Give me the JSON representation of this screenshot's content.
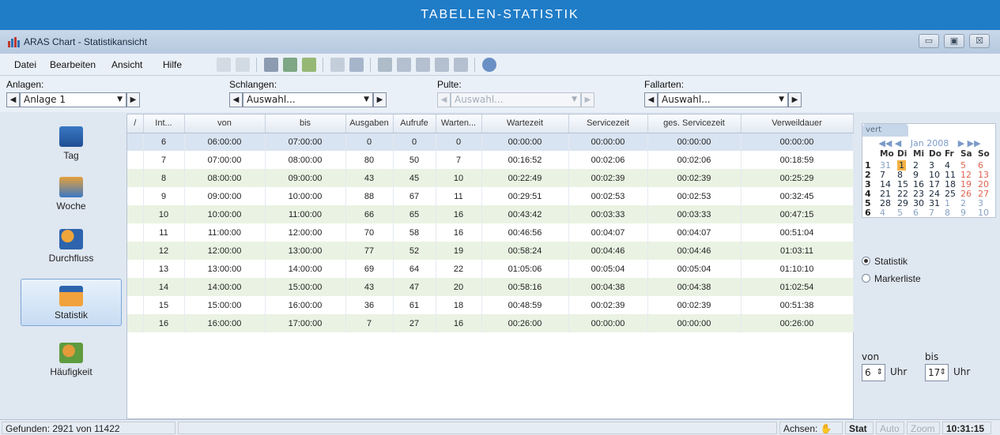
{
  "banner": {
    "title": "TABELLEN-STATISTIK"
  },
  "window": {
    "title": "ARAS Chart - Statistikansicht",
    "btn_min": "▭",
    "btn_max": "▣",
    "btn_close": "☒"
  },
  "menu": {
    "datei": "Datei",
    "bearbeiten": "Bearbeiten",
    "ansicht": "Ansicht",
    "hilfe": "Hilfe"
  },
  "filters": {
    "anlagen": {
      "label": "Anlagen:",
      "value": "Anlage 1"
    },
    "schlangen": {
      "label": "Schlangen:",
      "value": "Auswahl..."
    },
    "pulte": {
      "label": "Pulte:",
      "value": "Auswahl..."
    },
    "fallarten": {
      "label": "Fallarten:",
      "value": "Auswahl..."
    },
    "arrow_left": "◀",
    "arrow_right": "▶",
    "dropdown": "▼"
  },
  "sidebar": {
    "items": [
      {
        "label": "Tag",
        "icon": "calendar-day-icon"
      },
      {
        "label": "Woche",
        "icon": "calendar-week-icon"
      },
      {
        "label": "Durchfluss",
        "icon": "people-flow-icon"
      },
      {
        "label": "Statistik",
        "icon": "statistics-grid-icon"
      },
      {
        "label": "Häufigkeit",
        "icon": "frequency-people-icon"
      }
    ]
  },
  "table": {
    "columns": [
      "/",
      "Int...",
      "von",
      "bis",
      "Ausgaben",
      "Aufrufe",
      "Warten...",
      "Wartezeit",
      "Servicezeit",
      "ges. Servicezeit",
      "Verweildauer"
    ],
    "rows": [
      [
        "",
        "6",
        "06:00:00",
        "07:00:00",
        "0",
        "0",
        "0",
        "00:00:00",
        "00:00:00",
        "00:00:00",
        "00:00:00"
      ],
      [
        "",
        "7",
        "07:00:00",
        "08:00:00",
        "80",
        "50",
        "7",
        "00:16:52",
        "00:02:06",
        "00:02:06",
        "00:18:59"
      ],
      [
        "",
        "8",
        "08:00:00",
        "09:00:00",
        "43",
        "45",
        "10",
        "00:22:49",
        "00:02:39",
        "00:02:39",
        "00:25:29"
      ],
      [
        "",
        "9",
        "09:00:00",
        "10:00:00",
        "88",
        "67",
        "11",
        "00:29:51",
        "00:02:53",
        "00:02:53",
        "00:32:45"
      ],
      [
        "",
        "10",
        "10:00:00",
        "11:00:00",
        "66",
        "65",
        "16",
        "00:43:42",
        "00:03:33",
        "00:03:33",
        "00:47:15"
      ],
      [
        "",
        "11",
        "11:00:00",
        "12:00:00",
        "70",
        "58",
        "16",
        "00:46:56",
        "00:04:07",
        "00:04:07",
        "00:51:04"
      ],
      [
        "",
        "12",
        "12:00:00",
        "13:00:00",
        "77",
        "52",
        "19",
        "00:58:24",
        "00:04:46",
        "00:04:46",
        "01:03:11"
      ],
      [
        "",
        "13",
        "13:00:00",
        "14:00:00",
        "69",
        "64",
        "22",
        "01:05:06",
        "00:05:04",
        "00:05:04",
        "01:10:10"
      ],
      [
        "",
        "14",
        "14:00:00",
        "15:00:00",
        "43",
        "47",
        "20",
        "00:58:16",
        "00:04:38",
        "00:04:38",
        "01:02:54"
      ],
      [
        "",
        "15",
        "15:00:00",
        "16:00:00",
        "36",
        "61",
        "18",
        "00:48:59",
        "00:02:39",
        "00:02:39",
        "00:51:38"
      ],
      [
        "",
        "16",
        "16:00:00",
        "17:00:00",
        "7",
        "27",
        "16",
        "00:26:00",
        "00:00:00",
        "00:00:00",
        "00:26:00"
      ]
    ]
  },
  "calendar": {
    "tab": "vert",
    "month": "Jan 2008",
    "nav_prev": "◀◀ ◀",
    "nav_next": "▶ ▶▶",
    "weekdays": [
      "Mo",
      "Di",
      "Mi",
      "Do",
      "Fr",
      "Sa",
      "So"
    ],
    "weeks": [
      {
        "wk": "1",
        "days": [
          "31",
          "1",
          "2",
          "3",
          "4",
          "5",
          "6"
        ]
      },
      {
        "wk": "2",
        "days": [
          "7",
          "8",
          "9",
          "10",
          "11",
          "12",
          "13"
        ]
      },
      {
        "wk": "3",
        "days": [
          "14",
          "15",
          "16",
          "17",
          "18",
          "19",
          "20"
        ]
      },
      {
        "wk": "4",
        "days": [
          "21",
          "22",
          "23",
          "24",
          "25",
          "26",
          "27"
        ]
      },
      {
        "wk": "5",
        "days": [
          "28",
          "29",
          "30",
          "31",
          "1",
          "2",
          "3"
        ]
      },
      {
        "wk": "6",
        "days": [
          "4",
          "5",
          "6",
          "7",
          "8",
          "9",
          "10"
        ]
      }
    ],
    "selected_day": "1"
  },
  "view_mode": {
    "statistik": "Statistik",
    "markerliste": "Markerliste",
    "selected": "Statistik"
  },
  "time_range": {
    "von_label": "von",
    "bis_label": "bis",
    "von_value": "6",
    "bis_value": "17",
    "unit": "Uhr",
    "spin": "⇕"
  },
  "status": {
    "found": "Gefunden: 2921 von 11422",
    "achsen": "Achsen:",
    "stat": "Stat",
    "auto": "Auto",
    "zoom": "Zoom",
    "time": "10:31:15"
  }
}
